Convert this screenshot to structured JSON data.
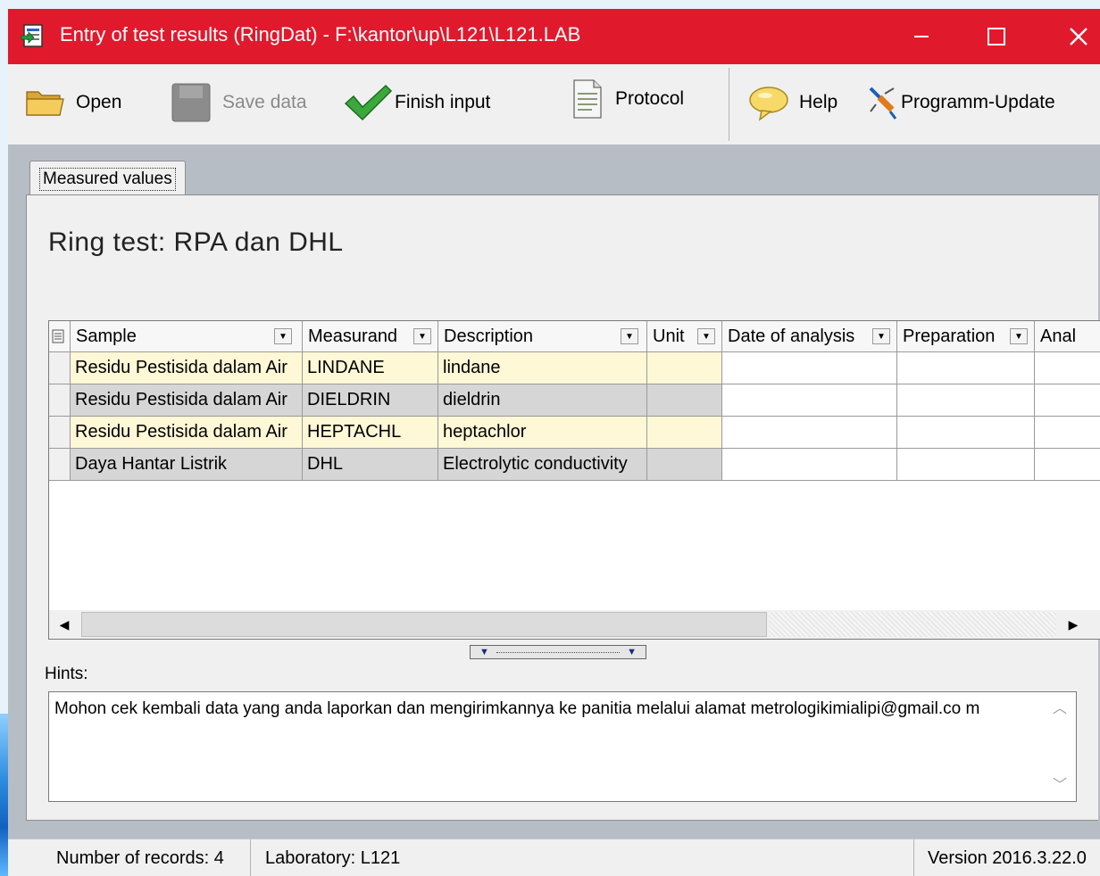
{
  "window": {
    "title": "Entry of test results (RingDat) - F:\\kantor\\up\\L121\\L121.LAB"
  },
  "toolbar": {
    "open": "Open",
    "save": "Save data",
    "finish": "Finish input",
    "protocol": "Protocol",
    "help": "Help",
    "update": "Programm-Update"
  },
  "tab": {
    "label": "Measured values"
  },
  "ring": {
    "title": "Ring test: RPA dan DHL"
  },
  "grid": {
    "headers": [
      "Sample",
      "Measurand",
      "Description",
      "Unit",
      "Date of analysis",
      "Preparation",
      "Anal"
    ],
    "rows": [
      {
        "sample": "Residu Pestisida dalam Air",
        "measurand": "LINDANE",
        "description": "lindane",
        "unit": ""
      },
      {
        "sample": "Residu Pestisida dalam Air",
        "measurand": "DIELDRIN",
        "description": "dieldrin",
        "unit": ""
      },
      {
        "sample": "Residu Pestisida dalam Air",
        "measurand": "HEPTACHL",
        "description": "heptachlor",
        "unit": ""
      },
      {
        "sample": "Daya Hantar Listrik",
        "measurand": "DHL",
        "description": "Electrolytic conductivity",
        "unit": ""
      }
    ]
  },
  "hints": {
    "label": "Hints:",
    "text": "Mohon cek kembali data  yang anda laporkan dan  mengirimkannya ke panitia  melalui  alamat metrologikimialipi@gmail.co m"
  },
  "status": {
    "records": "Number of records: 4",
    "lab": "Laboratory: L121",
    "version": "Version 2016.3.22.0"
  },
  "colors": {
    "titlebar": "#e1192d",
    "row_yellow": "#fff8d6",
    "row_gray": "#d6d6d6"
  }
}
